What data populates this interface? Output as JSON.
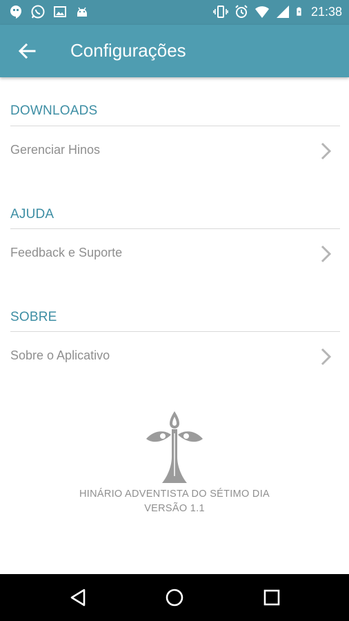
{
  "status_bar": {
    "time": "21:38",
    "left_icons": [
      "hangouts-icon",
      "whatsapp-icon",
      "gallery-icon",
      "android-icon"
    ],
    "right_icons": [
      "vibrate-icon",
      "alarm-icon",
      "wifi-icon",
      "signal-icon",
      "battery-charging-icon"
    ]
  },
  "app_bar": {
    "title": "Configurações",
    "back_icon": "arrow-back-icon",
    "background": "#4f9db1"
  },
  "sections": [
    {
      "header": "DOWNLOADS",
      "item": "Gerenciar Hinos"
    },
    {
      "header": "AJUDA",
      "item": "Feedback e Suporte"
    },
    {
      "header": "SOBRE",
      "item": "Sobre o Aplicativo"
    }
  ],
  "footer": {
    "app_name": "HINÁRIO ADVENTISTA DO SÉTIMO DIA",
    "version": "VERSÃO 1.1",
    "logo": "adventist-logo"
  },
  "nav_bar": {
    "buttons": [
      "back-triangle-icon",
      "home-circle-icon",
      "recents-square-icon"
    ]
  },
  "colors": {
    "accent": "#3d8ea4",
    "item_text": "#8f8f8f",
    "divider": "#d9d9d9"
  }
}
